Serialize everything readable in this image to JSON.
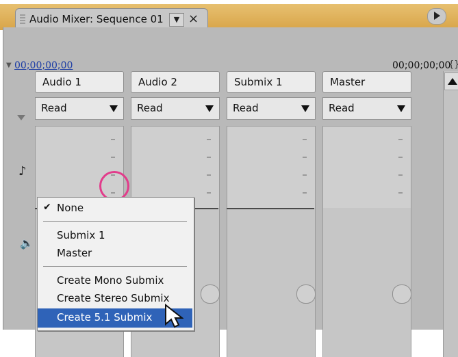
{
  "window": {
    "tab_title": "Audio Mixer: Sequence 01",
    "tab_menu_glyph": "▼",
    "tab_close_glyph": "×",
    "timecode_left": "00;00;00;00",
    "timecode_right": "00;00;00;00"
  },
  "tracks": [
    {
      "name": "Audio 1",
      "mode": "Read"
    },
    {
      "name": "Audio 2",
      "mode": "Read"
    },
    {
      "name": "Submix 1",
      "mode": "Read"
    },
    {
      "name": "Master",
      "mode": "Read"
    }
  ],
  "menu": {
    "checked_item": "None",
    "items": [
      "Submix 1",
      "Master"
    ],
    "create_items": [
      "Create Mono Submix",
      "Create Stereo Submix",
      "Create 5.1 Submix"
    ]
  },
  "icons": {
    "panel_menu": "play-triangle-icon",
    "track_dropdown": "dropdown-arrow-icon",
    "tab_grip": "grip-icon",
    "left_1": "music-note-icon",
    "left_2": "speaker-icon",
    "scroll_up": "scroll-up-icon",
    "small_menu": "small-dropdown-button-icon"
  },
  "colors": {
    "accent_orange": "#e7c070",
    "selection_blue": "#2f63b8",
    "highlight_magenta": "#e23c8b"
  }
}
